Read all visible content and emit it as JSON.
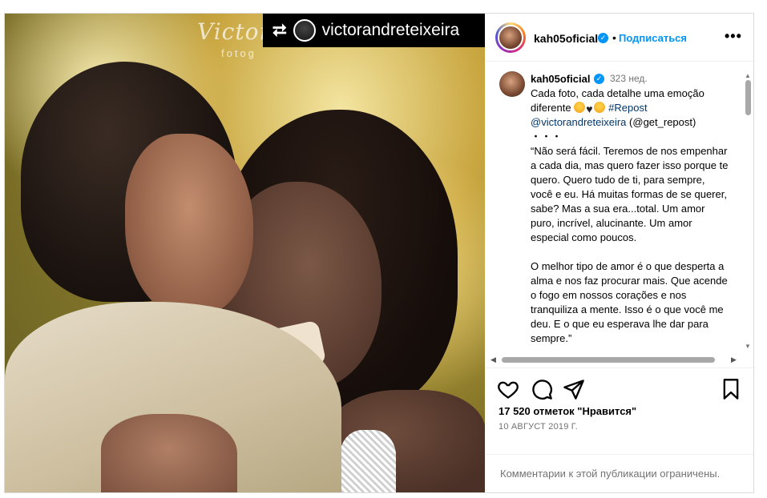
{
  "photo": {
    "watermark": "Victor",
    "watermark_sub": "fotog"
  },
  "repost_banner": {
    "username": "victorandreteixeira",
    "icon": "repost-icon"
  },
  "header": {
    "username": "kah05oficial",
    "separator": "•",
    "follow_label": "Подписаться",
    "more_label": "•••"
  },
  "caption": {
    "username": "kah05oficial",
    "time": "323 нед.",
    "text_line1": "Cada foto, cada detalhe uma emoção",
    "text_line2_prefix": "diferente ",
    "hashtag": "#Repost",
    "mention": "@victorandreteixeira",
    "mention2": "(@get_repost)",
    "dots": "・・・",
    "paragraph1": "“Não será fácil. Teremos de nos empenhar a cada dia, mas quero fazer isso porque te quero. Quero tudo de ti, para sempre, você e eu. Há muitas formas de se querer, sabe? Mas a sua era...total. Um amor puro, incrível, alucinante. Um amor especial como poucos.",
    "paragraph2": "O melhor tipo de amor é o que desperta a alma e nos faz procurar mais. Que acende o fogo em nossos corações e nos tranquiliza a mente. Isso é o que você me deu. E o que eu esperava lhe dar para sempre.”"
  },
  "actions": {
    "like_icon": "heart-icon",
    "comment_icon": "comment-icon",
    "share_icon": "share-icon",
    "save_icon": "bookmark-icon"
  },
  "likes_text": "17 520 отметок \"Нравится\"",
  "date_text": "10 АВГУСТ 2019 Г.",
  "comments_limited": "Комментарии к этой публикации ограничены.",
  "colors": {
    "accent": "#0095f6",
    "secondary_text": "#737373",
    "link": "#00376b"
  }
}
